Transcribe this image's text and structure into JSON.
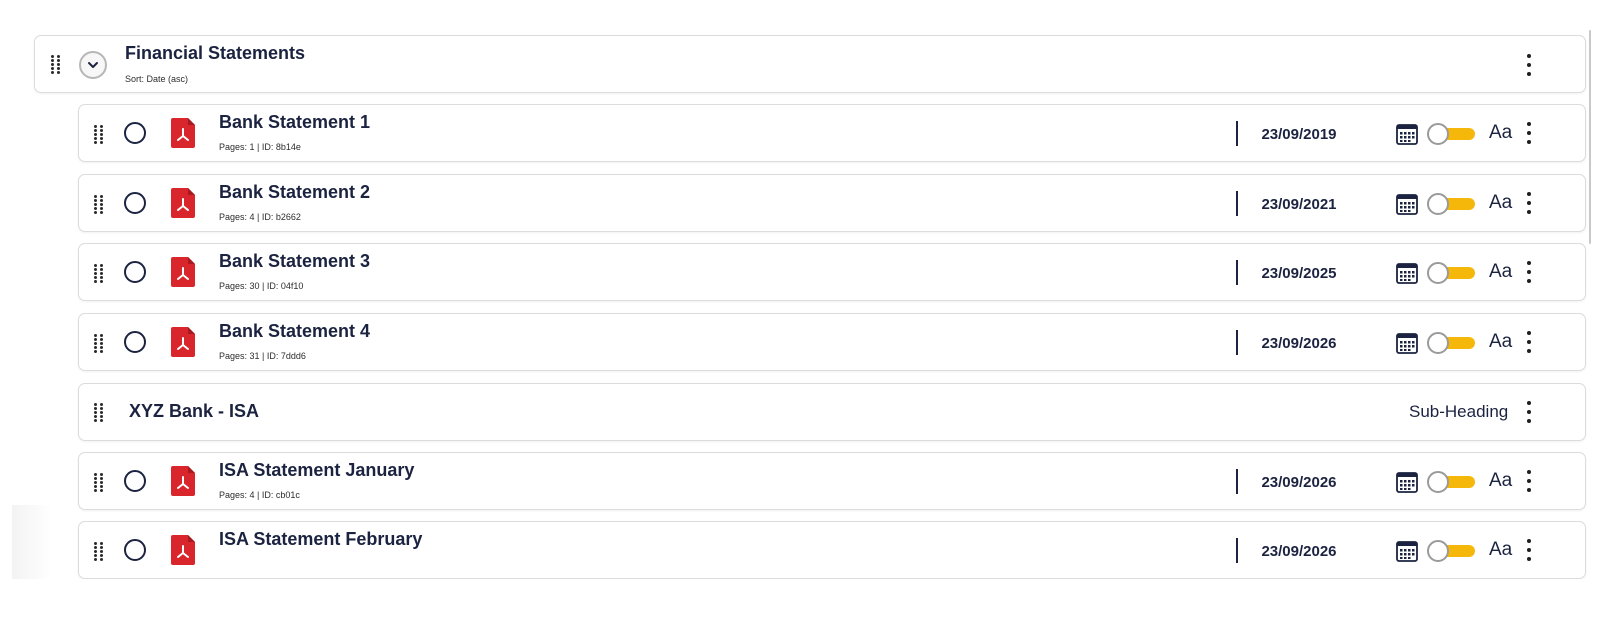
{
  "group": {
    "title": "Financial Statements",
    "sort_label": "Sort: Date (asc)",
    "expand_icon": "chevron-down-icon"
  },
  "documents": [
    {
      "title": "Bank Statement 1",
      "meta": "Pages: 1 | ID: 8b14e",
      "date": "23/09/2019",
      "font_label": "Aa"
    },
    {
      "title": "Bank Statement 2",
      "meta": "Pages: 4 | ID: b2662",
      "date": "23/09/2021",
      "font_label": "Aa"
    },
    {
      "title": "Bank Statement 3",
      "meta": "Pages: 30 | ID: 04f10",
      "date": "23/09/2025",
      "font_label": "Aa"
    },
    {
      "title": "Bank Statement 4",
      "meta": "Pages: 31 | ID: 7ddd6",
      "date": "23/09/2026",
      "font_label": "Aa"
    }
  ],
  "subheading": {
    "title": "XYZ Bank - ISA",
    "type_label": "Sub-Heading"
  },
  "isa_documents": [
    {
      "title": "ISA Statement January",
      "meta": "Pages: 4 | ID: cb01c",
      "date": "23/09/2026",
      "font_label": "Aa"
    },
    {
      "title": "ISA Statement February",
      "meta": "",
      "date": "23/09/2026",
      "font_label": "Aa"
    }
  ],
  "colors": {
    "text_navy": "#1b2340",
    "pdf_red": "#d9262c",
    "toggle_yellow": "#f5b80a",
    "border": "#dcdcdc"
  },
  "icons": [
    "drag-handle-icon",
    "chevron-down-icon",
    "kebab-menu-icon",
    "radio-circle-icon",
    "pdf-file-icon",
    "calendar-icon"
  ]
}
